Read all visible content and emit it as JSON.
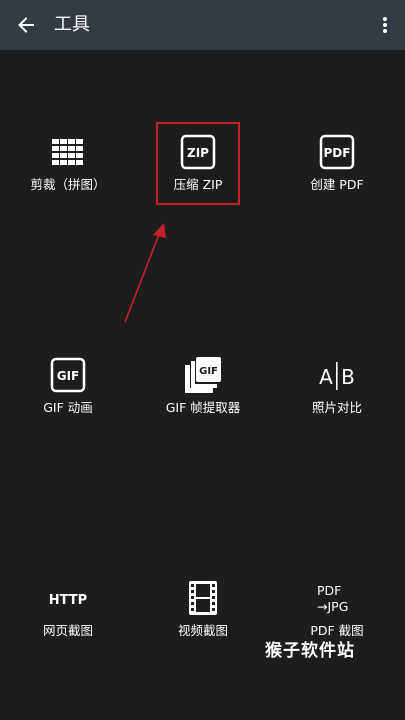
{
  "appbar": {
    "title": "工具",
    "back_icon": "arrow-left-icon",
    "menu_icon": "more-vert-icon",
    "background": "#333b43"
  },
  "tools": {
    "crop": {
      "label": "剪裁（拼图）",
      "icon": "grid-icon"
    },
    "zip": {
      "label": "压缩 ZIP",
      "icon": "zip-icon",
      "icon_text": "ZIP"
    },
    "pdf": {
      "label": "创建 PDF",
      "icon": "pdf-icon",
      "icon_text": "PDF"
    },
    "gif": {
      "label": "GIF 动画",
      "icon": "gif-icon",
      "icon_text": "GIF"
    },
    "gif_extract": {
      "label": "GIF 帧提取器",
      "icon": "gif-stack-icon",
      "icon_text": "GIF"
    },
    "compare": {
      "label": "照片对比",
      "icon": "ab-compare-icon",
      "icon_text_a": "A",
      "icon_text_b": "B"
    },
    "web": {
      "label": "网页截图",
      "icon": "http-icon",
      "icon_text": "HTTP"
    },
    "video": {
      "label": "视频截图",
      "icon": "film-icon"
    },
    "pdf_capture": {
      "label": "PDF 截图",
      "icon": "pdf-to-jpg-icon",
      "icon_text_top": "PDF",
      "icon_text_bottom": "→JPG"
    }
  },
  "annotation": {
    "highlight_color": "#c7202b",
    "arrow_color": "#c7202b"
  },
  "watermark": {
    "text": "猴子软件站"
  }
}
